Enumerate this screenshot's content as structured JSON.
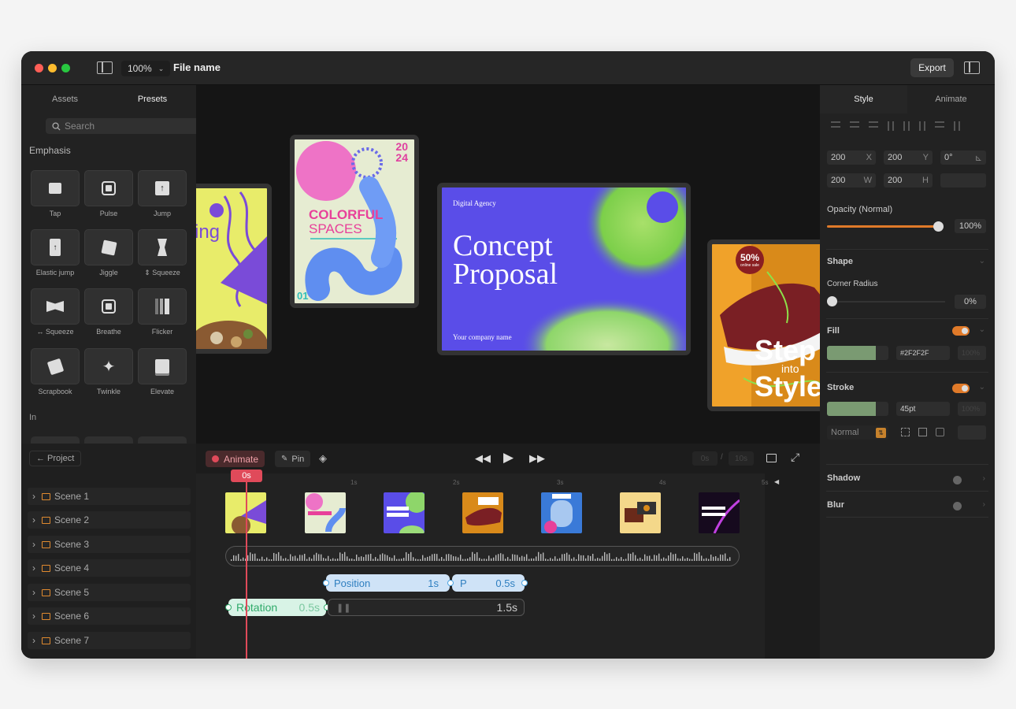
{
  "titlebar": {
    "zoom": "100%",
    "file_name": "File name",
    "export_label": "Export"
  },
  "left_panel": {
    "tabs": [
      "Assets",
      "Presets"
    ],
    "search_placeholder": "Search",
    "emphasis_label": "Emphasis",
    "in_label": "In",
    "presets": [
      "Tap",
      "Pulse",
      "Jump",
      "Elastic jump",
      "Jiggle",
      "⇕ Squeeze",
      "↔ Squeeze",
      "Breathe",
      "Flicker",
      "Scrapbook",
      "Twinkle",
      "Elevate"
    ]
  },
  "canvas": {
    "card_left_text": "ing",
    "card_colorful": {
      "year_top": "20",
      "year_bottom": "24",
      "title1": "COLORFUL",
      "title2": "SPACES",
      "page": "01"
    },
    "card_concept": {
      "agency": "Digital Agency",
      "title1": "Concept",
      "title2": "Proposal",
      "company": "Your company name"
    },
    "card_step": {
      "badge_big": "50%",
      "badge_small": "online sale",
      "title1": "Step",
      "title2": "into",
      "title3": "Style"
    }
  },
  "right_panel": {
    "tabs": [
      "Style",
      "Animate"
    ],
    "x": "200",
    "x_axis": "X",
    "y": "200",
    "y_axis": "Y",
    "rotation": "0°",
    "w": "200",
    "w_axis": "W",
    "h": "200",
    "h_axis": "H",
    "opacity_label": "Opacity (Normal)",
    "opacity_value": "100%",
    "opacity_level": 0.98,
    "shape_label": "Shape",
    "corner_radius_label": "Corner Radius",
    "corner_radius_value": "0%",
    "fill_label": "Fill",
    "fill_hex": "#2F2F2F",
    "fill_pct": "100%",
    "stroke_label": "Stroke",
    "stroke_width": "45pt",
    "stroke_pct": "100%",
    "blend_mode": "Normal",
    "shadow_label": "Shadow",
    "blur_label": "Blur",
    "swatch_color": "#7a9a72",
    "accent": "#e07a29"
  },
  "timeline": {
    "project_label": "← Project",
    "animate_label": "Animate",
    "pin_label": "Pin",
    "playhead": "0s",
    "ticks": [
      "1s",
      "2s",
      "3s",
      "4s",
      "5s"
    ],
    "time_current": "0s",
    "time_sep": "/",
    "time_total": "10s",
    "scenes": [
      "Scene 1",
      "Scene 2",
      "Scene 3",
      "Scene 4",
      "Scene 5",
      "Scene 6",
      "Scene 7"
    ],
    "keyframes": {
      "position_label": "Position",
      "position_dur": "1s",
      "p_label": "P",
      "p_dur": "0.5s",
      "rotation_label": "Rotation",
      "rotation_dur": "0.5s",
      "rotation_tail": "1.5s"
    }
  }
}
